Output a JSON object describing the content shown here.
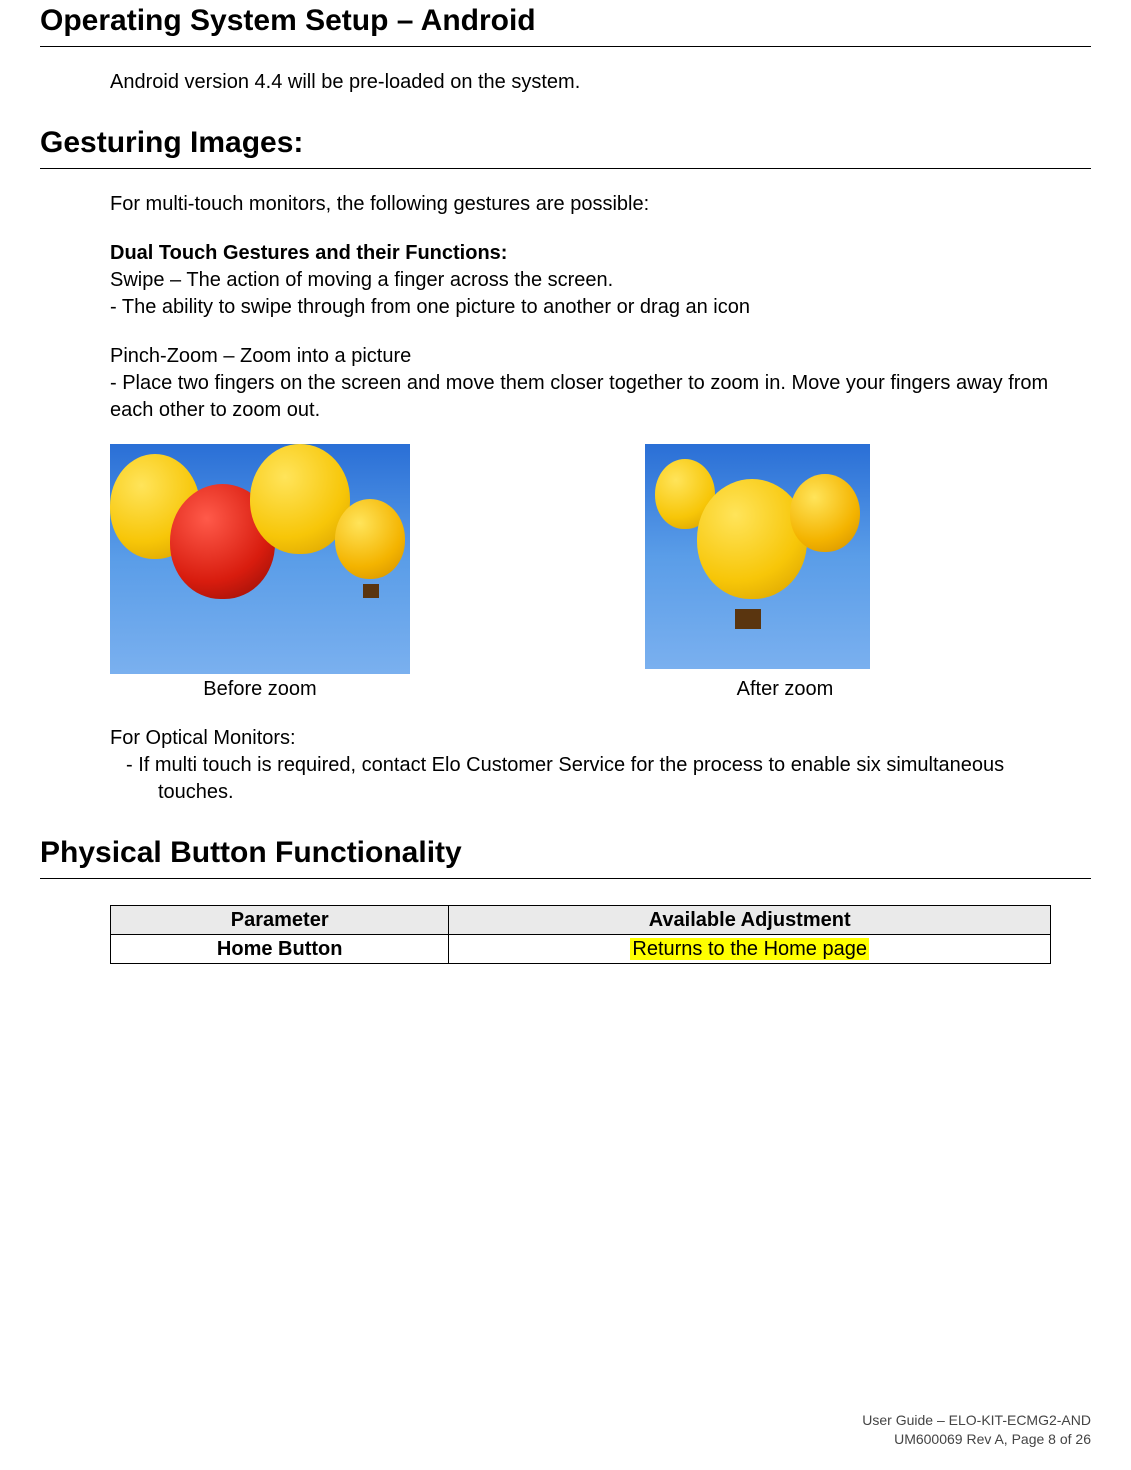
{
  "headings": {
    "os_setup": "Operating System Setup – Android",
    "gesturing": "Gesturing Images:",
    "physical": "Physical Button Functionality"
  },
  "os": {
    "line": "Android version 4.4 will be pre-loaded on the system."
  },
  "gestures": {
    "intro": "For multi-touch monitors, the following gestures are possible:",
    "dual_title": "Dual Touch Gestures and their Functions:",
    "swipe_line": "Swipe – The action of moving a finger across the screen.",
    "swipe_bullet": "-  The ability to swipe through from one picture to another or drag an icon",
    "pinch_line": "Pinch-Zoom – Zoom into a picture",
    "pinch_desc": "- Place two fingers on the screen and move them closer together to zoom in. Move your fingers away from each other to zoom out.",
    "captions": {
      "before": "Before zoom",
      "after": "After zoom"
    },
    "optical_title": "For Optical Monitors:",
    "optical_bullet": "-  If multi touch is required, contact Elo Customer Service for the process to enable six simultaneous touches."
  },
  "table": {
    "headers": [
      "Parameter",
      "Available Adjustment"
    ],
    "rows": [
      {
        "param": "Home Button",
        "adjust": "Returns to the Home page"
      }
    ]
  },
  "footer": {
    "line1": "User  Guide  –  ELO-KIT-ECMG2-AND",
    "line2": "UM600069  Rev  A,  Page  8  of  26"
  }
}
